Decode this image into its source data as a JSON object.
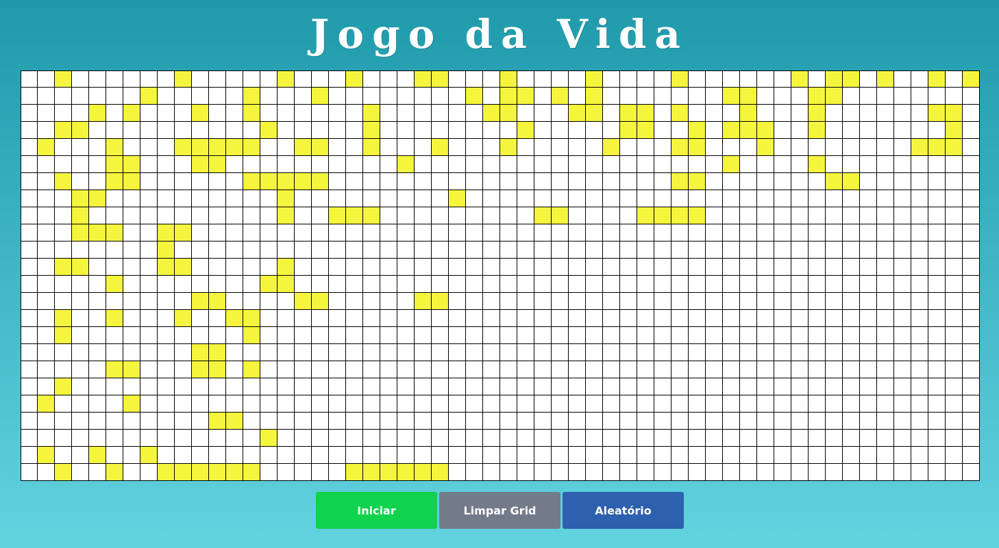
{
  "header": {
    "title": "Jogo da Vida"
  },
  "colors": {
    "alive": "#f5f53e",
    "dead": "#ffffff",
    "gridline": "#000000",
    "start_button": "#0fd24d",
    "clear_button": "#737a8a",
    "random_button": "#2d60ae"
  },
  "board": {
    "cols": 56,
    "rows": 24,
    "cells": [
      "..Y......Y.....Y...Y...YY...Y....Y....Y......Y.YY.Y..Y.Y...YY.....Y......Y",
      ".......Y.....Y...Y........Y.YY.Y.Y.......YY...YY........YY......Y...",
      "....Y.Y...Y..Y......Y......YY...YY.YY.Y...Y...Y......YY......YY..",
      "..YY..........Y.....Y........Y.....YY..Y.YYY..Y.......Y.Y.YY...",
      ".Y...Y...YYYYY..YY..Y...Y...Y.....Y...YY...Y........YYY.YY.Y.",
      ".....YY...YY..........Y..................Y....Y.................",
      "..Y..YY......YYYYY....................YY.......YY.......Y.....YYY.",
      "...YY..........Y.........Y............................",
      "...Y...........Y..YYY.........YY....YYYY...................",
      "...YYY..YY..........................................",
      "........Y........................................................",
      "..YY....YY.....Y.....................................",
      ".....Y........YY..............................................",
      "..........YY....YY.....YY.........................................",
      "..Y..Y...Y..YY.......................................................",
      "..Y..........Y...............................................",
      "..........YY.......................................................",
      ".....YY...YY.Y..........................................................",
      "..Y........................................................",
      ".Y....Y.......................................................",
      "...........YY..........................................",
      "..............Y..............................................",
      ".Y..Y..Y.........................................",
      "..Y..Y..YYYYYY.....YYYYYY..........................."
    ]
  },
  "controls": {
    "start_label": "Iniciar",
    "clear_label": "Limpar Grid",
    "random_label": "Aleatório"
  }
}
